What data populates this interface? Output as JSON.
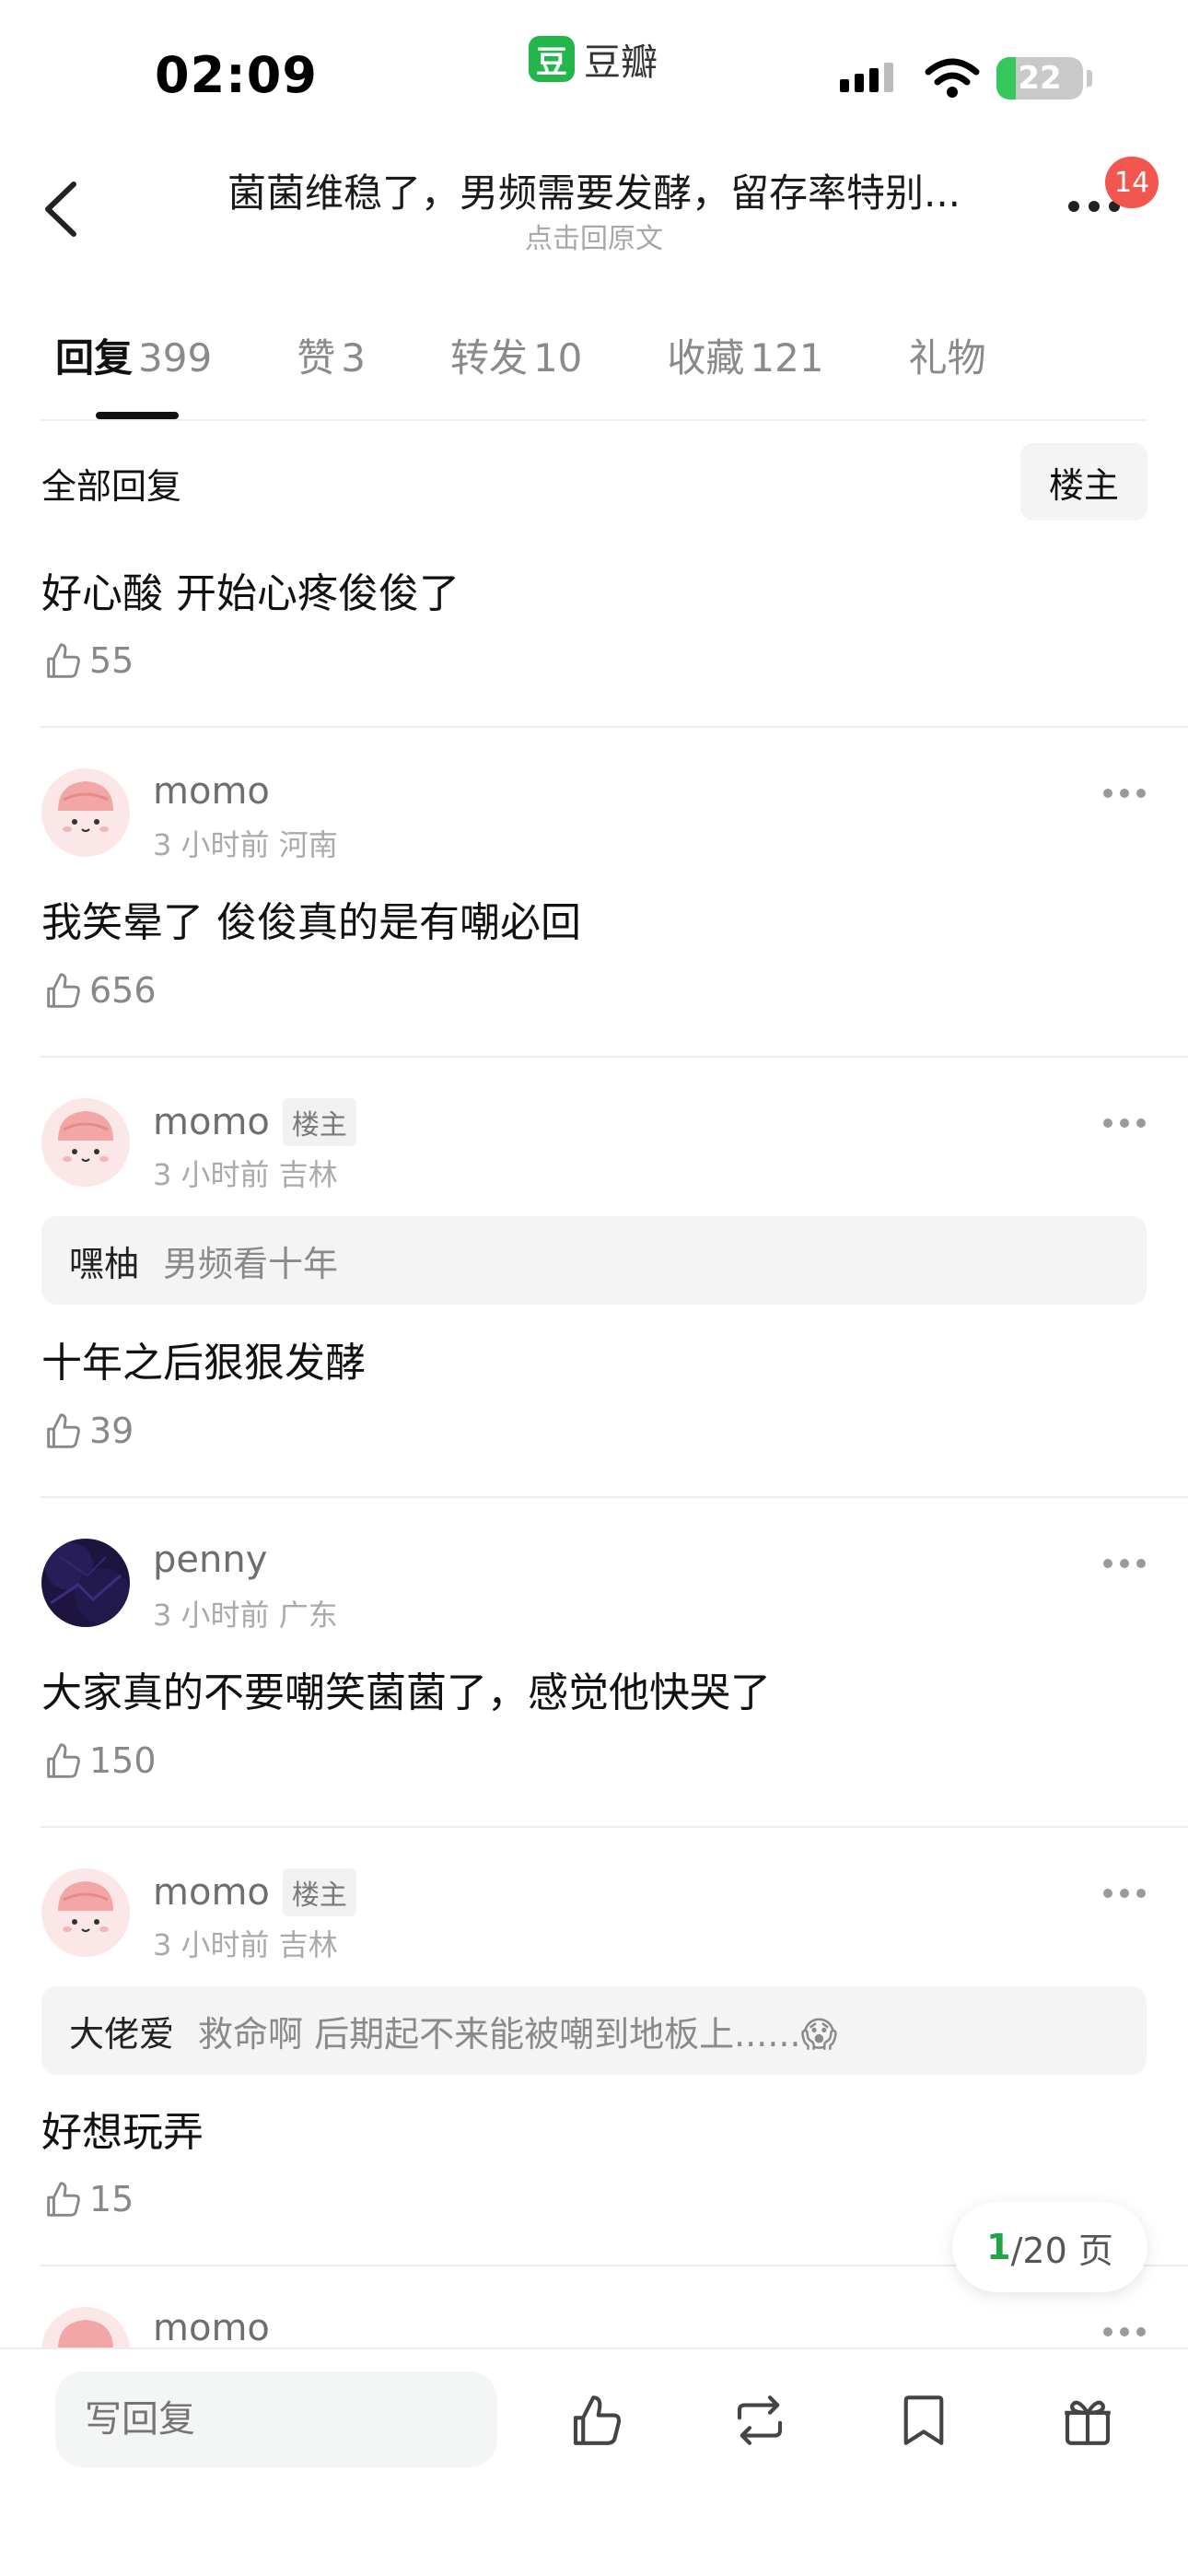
{
  "status_bar": {
    "time": "02:09",
    "app_logo_char": "豆",
    "app_name": "豆瓣",
    "battery": "22",
    "battery_level": 0.22,
    "battery_color": "#34c759"
  },
  "header": {
    "title": "菌菌维稳了，男频需要发酵，留存率特别...",
    "subtitle": "点击回原文",
    "notification_count": "14"
  },
  "tabs": [
    {
      "label": "回复",
      "count": "399",
      "active": true
    },
    {
      "label": "赞",
      "count": "3"
    },
    {
      "label": "转发",
      "count": "10"
    },
    {
      "label": "收藏",
      "count": "121"
    },
    {
      "label": "礼物",
      "count": ""
    }
  ],
  "replies_header": {
    "label": "全部回复",
    "filter_button": "楼主"
  },
  "comments": [
    {
      "text": "好心酸 开始心疼俊俊了",
      "likes": "55"
    },
    {
      "user": "momo",
      "meta": "3 小时前 河南",
      "text": "我笑晕了 俊俊真的是有嘲必回",
      "likes": "656"
    },
    {
      "user": "momo",
      "op_tag": "楼主",
      "meta": "3 小时前 吉林",
      "quote_user": "嘿柚",
      "quote_text": "男频看十年",
      "text": "十年之后狠狠发酵",
      "likes": "39"
    },
    {
      "user": "penny",
      "meta": "3 小时前 广东",
      "text": "大家真的不要嘲笑菌菌了，感觉他快哭了",
      "likes": "150"
    },
    {
      "user": "momo",
      "op_tag": "楼主",
      "meta": "3 小时前 吉林",
      "quote_user": "大佬爱",
      "quote_text": "救命啊  后期起不来能被嘲到地板上......😱",
      "text": "好想玩弄",
      "likes": "15"
    },
    {
      "user": "momo"
    }
  ],
  "pager": {
    "current": "1",
    "rest": "/20 页"
  },
  "bottom_bar": {
    "reply_placeholder": "写回复",
    "icons": [
      "thumbs-up-icon",
      "repost-icon",
      "bookmark-icon",
      "gift-icon"
    ]
  },
  "colors": {
    "accent": "#22a447",
    "badge": "#f2574f"
  }
}
